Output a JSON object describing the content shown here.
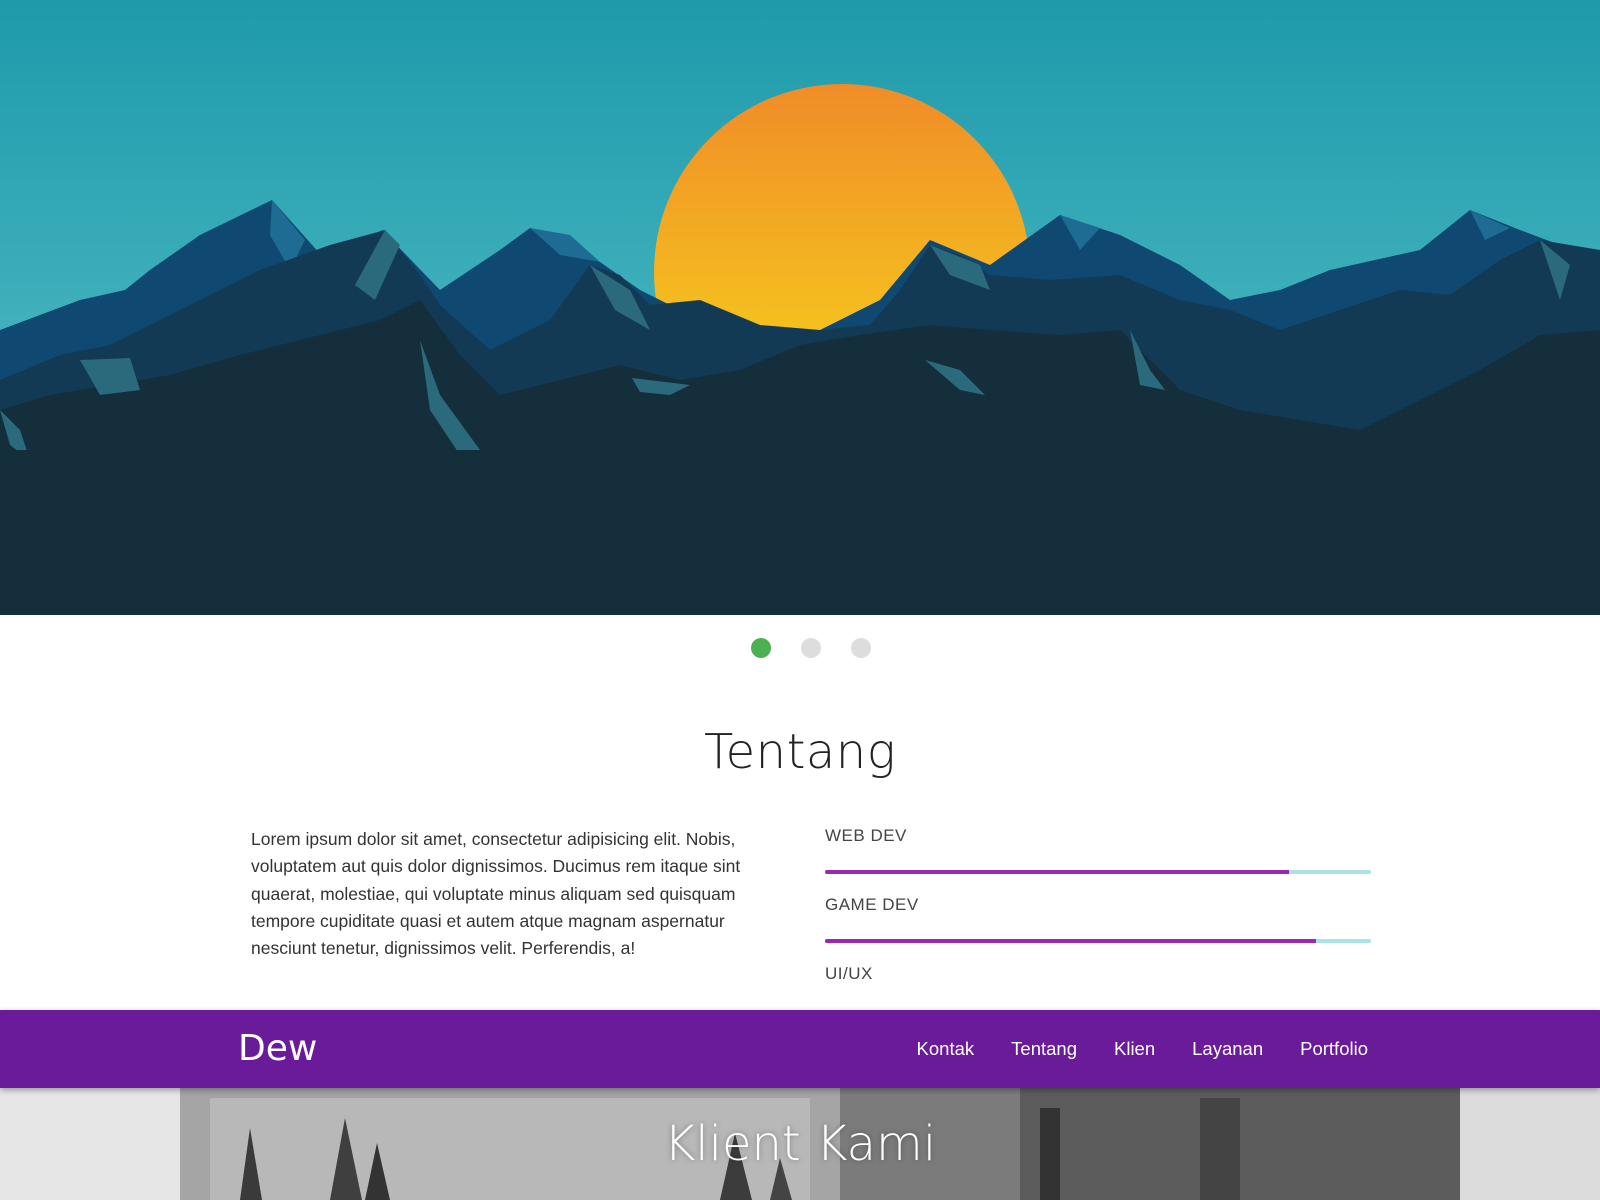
{
  "hero": {
    "slides": 3,
    "active_slide": 1,
    "colors": {
      "sky_top": "#1e9aab",
      "sky_bottom": "#57c0c8",
      "sun_top": "#f09128",
      "sun_bottom": "#f5d51c",
      "ground": "#15303c"
    }
  },
  "carousel": {
    "indicators": [
      {
        "active": true,
        "color": "#4caf50"
      },
      {
        "active": false,
        "color": "#dddddd"
      },
      {
        "active": false,
        "color": "#dddddd"
      }
    ]
  },
  "about": {
    "title": "Tentang",
    "text": "Lorem ipsum dolor sit amet, consectetur adipisicing elit. Nobis, voluptatem aut quis dolor dignissimos. Ducimus rem itaque sint quaerat, molestiae, qui voluptate minus aliquam sed quisquam tempore cupiditate quasi et autem atque magnam aspernatur nesciunt tenetur, dignissimos velit. Perferendis, a!",
    "skills": [
      {
        "label": "WEB DEV",
        "level": 0.85
      },
      {
        "label": "GAME DEV",
        "level": 0.9
      },
      {
        "label": "UI/UX",
        "level": null
      }
    ],
    "colors": {
      "bar_fill": "#9c27b0",
      "bar_track": "#a9e3e6"
    }
  },
  "navbar": {
    "brand": "Dew",
    "links": [
      "Kontak",
      "Tentang",
      "Klien",
      "Layanan",
      "Portfolio"
    ],
    "background": "#6a1b9a"
  },
  "clients": {
    "title": "Klient Kami"
  }
}
